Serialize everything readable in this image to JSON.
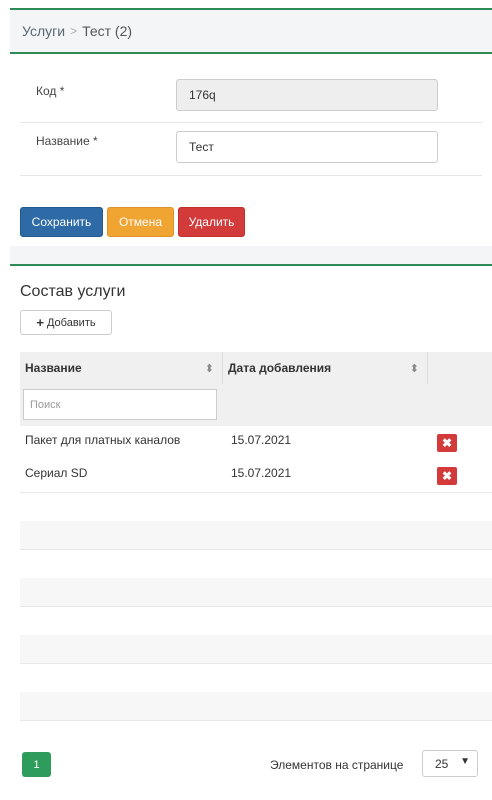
{
  "breadcrumb": {
    "parent": "Услуги",
    "separator": ">",
    "current": "Тест (2)"
  },
  "form": {
    "code_label": "Код *",
    "code_value": "176q",
    "name_label": "Название *",
    "name_value": "Тест"
  },
  "actions": {
    "save": "Сохранить",
    "cancel": "Отмена",
    "delete": "Удалить"
  },
  "composition": {
    "title": "Состав услуги",
    "add_label": "Добавить",
    "columns": [
      "Название",
      "Дата добавления"
    ],
    "search_placeholder": "Поиск",
    "rows": [
      {
        "name": "Пакет для платных каналов",
        "date": "15.07.2021"
      },
      {
        "name": "Сериал SD",
        "date": "15.07.2021"
      }
    ]
  },
  "pagination": {
    "current_page": "1",
    "per_page_label": "Элементов на странице",
    "per_page_value": "25"
  },
  "colors": {
    "accent": "#2e8b57",
    "save": "#2d6aa6",
    "cancel": "#f0a432",
    "delete": "#d33a3a"
  }
}
